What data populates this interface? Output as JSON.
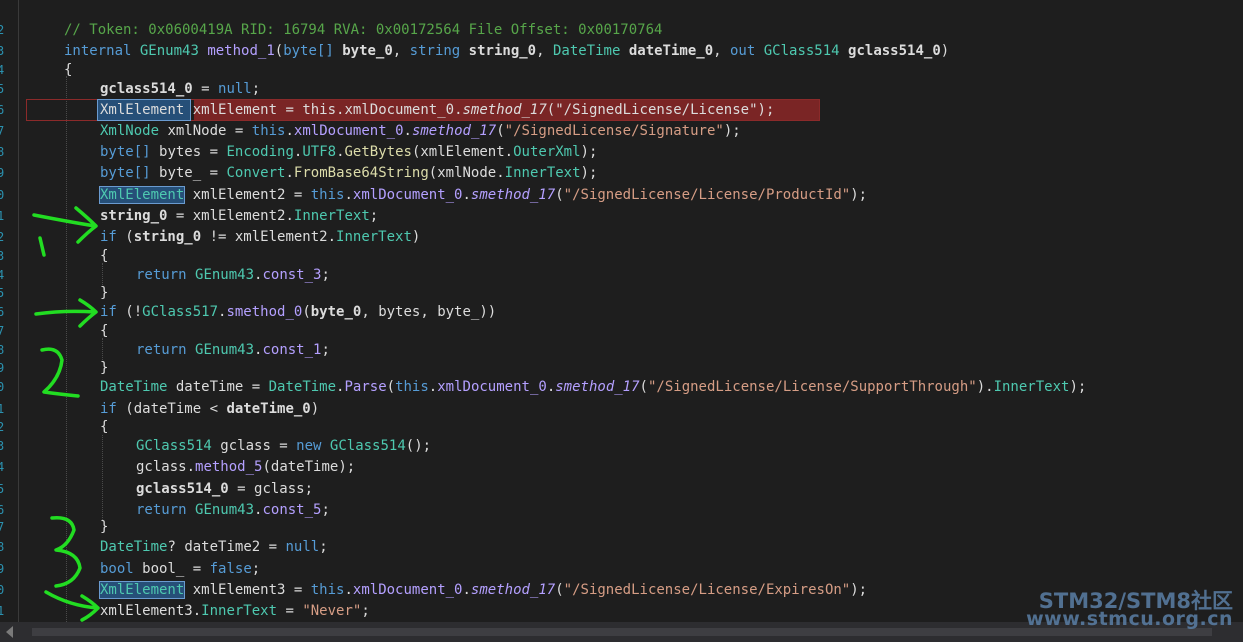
{
  "line_numbers": [
    "",
    "2",
    "3",
    "4",
    "5",
    "6",
    "7",
    "8",
    "9",
    "0",
    "1",
    "2",
    "3",
    "4",
    "5",
    "6",
    "7",
    "8",
    "9",
    "0",
    "1",
    "2",
    "3",
    "4",
    "5",
    "6",
    "7",
    "8",
    "9",
    "0",
    "1"
  ],
  "code": {
    "comment": "// Token: 0x0600419A RID: 16794 RVA: 0x00172564 File Offset: 0x00170764",
    "l2": {
      "internal": "internal",
      "ret_type": "GEnum43",
      "method": "method_1",
      "p1_type": "byte[]",
      "p1": "byte_0",
      "p2_type": "string",
      "p2": "string_0",
      "p3_type": "DateTime",
      "p3": "dateTime_0",
      "out": "out",
      "p4_type": "GClass514",
      "p4": "gclass514_0"
    },
    "open_brace": "{",
    "close_brace": "}",
    "l4": {
      "var": "gclass514_0",
      "eq": " = ",
      "null": "null",
      "semi": ";"
    },
    "l5": {
      "type": "XmlElement",
      "var": "xmlElement",
      "this": "this",
      "field": "xmlDocument_0",
      "method": "smethod_17",
      "arg": "\"/SignedLicense/License\""
    },
    "l6": {
      "type": "XmlNode",
      "var": "xmlNode",
      "this": "this",
      "field": "xmlDocument_0",
      "method": "smethod_17",
      "arg": "\"/SignedLicense/Signature\""
    },
    "l7": {
      "type": "byte[]",
      "var": "bytes",
      "cls": "Encoding",
      "prop": "UTF8",
      "method": "GetBytes",
      "arg": "xmlElement",
      "prop2": "OuterXml"
    },
    "l8": {
      "type": "byte[]",
      "var": "byte_",
      "cls": "Convert",
      "method": "FromBase64String",
      "arg": "xmlNode",
      "prop": "InnerText"
    },
    "l9": {
      "type": "XmlElement",
      "var": "xmlElement2",
      "this": "this",
      "field": "xmlDocument_0",
      "method": "smethod_17",
      "arg": "\"/SignedLicense/License/ProductId\""
    },
    "l10": {
      "var": "string_0",
      "rhs": "xmlElement2",
      "prop": "InnerText"
    },
    "l11": {
      "if": "if",
      "var": "string_0",
      "op": " != ",
      "rhs": "xmlElement2",
      "prop": "InnerText"
    },
    "l13": {
      "return": "return",
      "cls": "GEnum43",
      "member": "const_3"
    },
    "l15": {
      "if": "if",
      "cls": "GClass517",
      "method": "smethod_0",
      "a1": "byte_0",
      "a2": "bytes",
      "a3": "byte_"
    },
    "l17": {
      "return": "return",
      "cls": "GEnum43",
      "member": "const_1"
    },
    "l19": {
      "type": "DateTime",
      "var": "dateTime",
      "cls": "DateTime",
      "method": "Parse",
      "this": "this",
      "field": "xmlDocument_0",
      "m2": "smethod_17",
      "arg": "\"/SignedLicense/License/SupportThrough\"",
      "prop": "InnerText"
    },
    "l20": {
      "if": "if",
      "a": "dateTime",
      "op": " < ",
      "b": "dateTime_0"
    },
    "l22": {
      "type": "GClass514",
      "var": "gclass",
      "new": "new",
      "ctor": "GClass514"
    },
    "l23": {
      "obj": "gclass",
      "method": "method_5",
      "arg": "dateTime"
    },
    "l24": {
      "var": "gclass514_0",
      "rhs": "gclass"
    },
    "l25": {
      "return": "return",
      "cls": "GEnum43",
      "member": "const_5"
    },
    "l27": {
      "type": "DateTime",
      "q": "?",
      "var": "dateTime2",
      "null": "null"
    },
    "l28": {
      "type": "bool",
      "var": "bool_",
      "false": "false"
    },
    "l29": {
      "type": "XmlElement",
      "var": "xmlElement3",
      "this": "this",
      "field": "xmlDocument_0",
      "method": "smethod_17",
      "arg": "\"/SignedLicense/License/ExpiresOn\""
    },
    "l30": {
      "obj": "xmlElement3",
      "prop": "InnerText",
      "val": "\"Never\""
    }
  },
  "watermark": {
    "line1": "STM32/STM8社区",
    "line2": "www.stmcu.org.cn"
  },
  "colors": {
    "background": "#1e1e1e",
    "keyword": "#569cd6",
    "type": "#4ec9b0",
    "method": "#b4a0ff",
    "string": "#d69d85",
    "comment": "#57a64a",
    "error_highlight": "#7a2525",
    "annotation": "#22dd22"
  }
}
